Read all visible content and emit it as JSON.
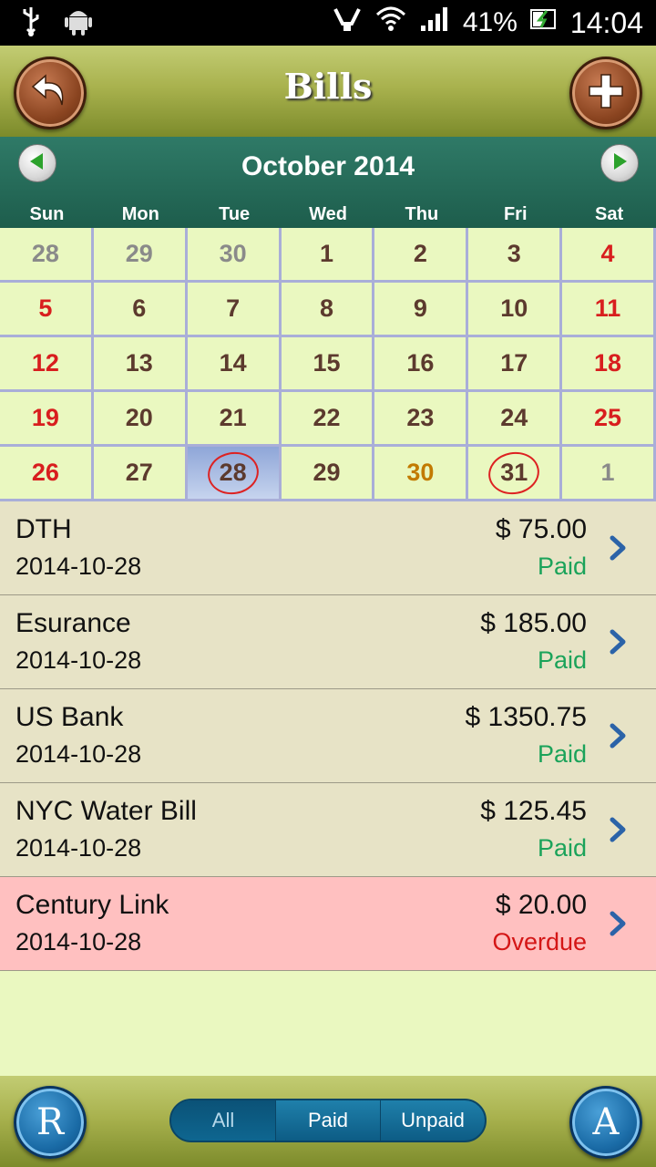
{
  "status_bar": {
    "battery": "41%",
    "time": "14:04"
  },
  "header": {
    "title": "Bills"
  },
  "calendar": {
    "month": "October 2014",
    "weekdays": [
      "Sun",
      "Mon",
      "Tue",
      "Wed",
      "Thu",
      "Fri",
      "Sat"
    ],
    "days": [
      {
        "n": "28",
        "kind": "other"
      },
      {
        "n": "29",
        "kind": "other"
      },
      {
        "n": "30",
        "kind": "other"
      },
      {
        "n": "1",
        "kind": "normal"
      },
      {
        "n": "2",
        "kind": "normal"
      },
      {
        "n": "3",
        "kind": "normal"
      },
      {
        "n": "4",
        "kind": "weekend"
      },
      {
        "n": "5",
        "kind": "weekend"
      },
      {
        "n": "6",
        "kind": "normal"
      },
      {
        "n": "7",
        "kind": "normal"
      },
      {
        "n": "8",
        "kind": "normal"
      },
      {
        "n": "9",
        "kind": "normal"
      },
      {
        "n": "10",
        "kind": "normal"
      },
      {
        "n": "11",
        "kind": "weekend"
      },
      {
        "n": "12",
        "kind": "weekend"
      },
      {
        "n": "13",
        "kind": "normal"
      },
      {
        "n": "14",
        "kind": "normal"
      },
      {
        "n": "15",
        "kind": "normal"
      },
      {
        "n": "16",
        "kind": "normal"
      },
      {
        "n": "17",
        "kind": "normal"
      },
      {
        "n": "18",
        "kind": "weekend"
      },
      {
        "n": "19",
        "kind": "weekend"
      },
      {
        "n": "20",
        "kind": "normal"
      },
      {
        "n": "21",
        "kind": "normal"
      },
      {
        "n": "22",
        "kind": "normal"
      },
      {
        "n": "23",
        "kind": "normal"
      },
      {
        "n": "24",
        "kind": "normal"
      },
      {
        "n": "25",
        "kind": "weekend"
      },
      {
        "n": "26",
        "kind": "weekend"
      },
      {
        "n": "27",
        "kind": "normal"
      },
      {
        "n": "28",
        "kind": "today",
        "circled": true
      },
      {
        "n": "29",
        "kind": "normal"
      },
      {
        "n": "30",
        "kind": "orange"
      },
      {
        "n": "31",
        "kind": "normal",
        "circled": true
      },
      {
        "n": "1",
        "kind": "other"
      }
    ]
  },
  "bills": [
    {
      "name": "DTH",
      "date": "2014-10-28",
      "amount": "$ 75.00",
      "status": "Paid",
      "overdue": false
    },
    {
      "name": "Esurance",
      "date": "2014-10-28",
      "amount": "$ 185.00",
      "status": "Paid",
      "overdue": false
    },
    {
      "name": "US Bank",
      "date": "2014-10-28",
      "amount": "$ 1350.75",
      "status": "Paid",
      "overdue": false
    },
    {
      "name": "NYC Water Bill",
      "date": "2014-10-28",
      "amount": "$ 125.45",
      "status": "Paid",
      "overdue": false
    },
    {
      "name": "Century Link",
      "date": "2014-10-28",
      "amount": "$ 20.00",
      "status": "Overdue",
      "overdue": true
    }
  ],
  "bottom": {
    "left_button": "R",
    "right_button": "A",
    "filters": [
      "All",
      "Paid",
      "Unpaid"
    ],
    "active_filter": "All"
  },
  "colors": {
    "paid": "#1ba35a",
    "overdue": "#d41616",
    "weekend": "#d81e1e",
    "header_green": "#1d5d4c"
  }
}
